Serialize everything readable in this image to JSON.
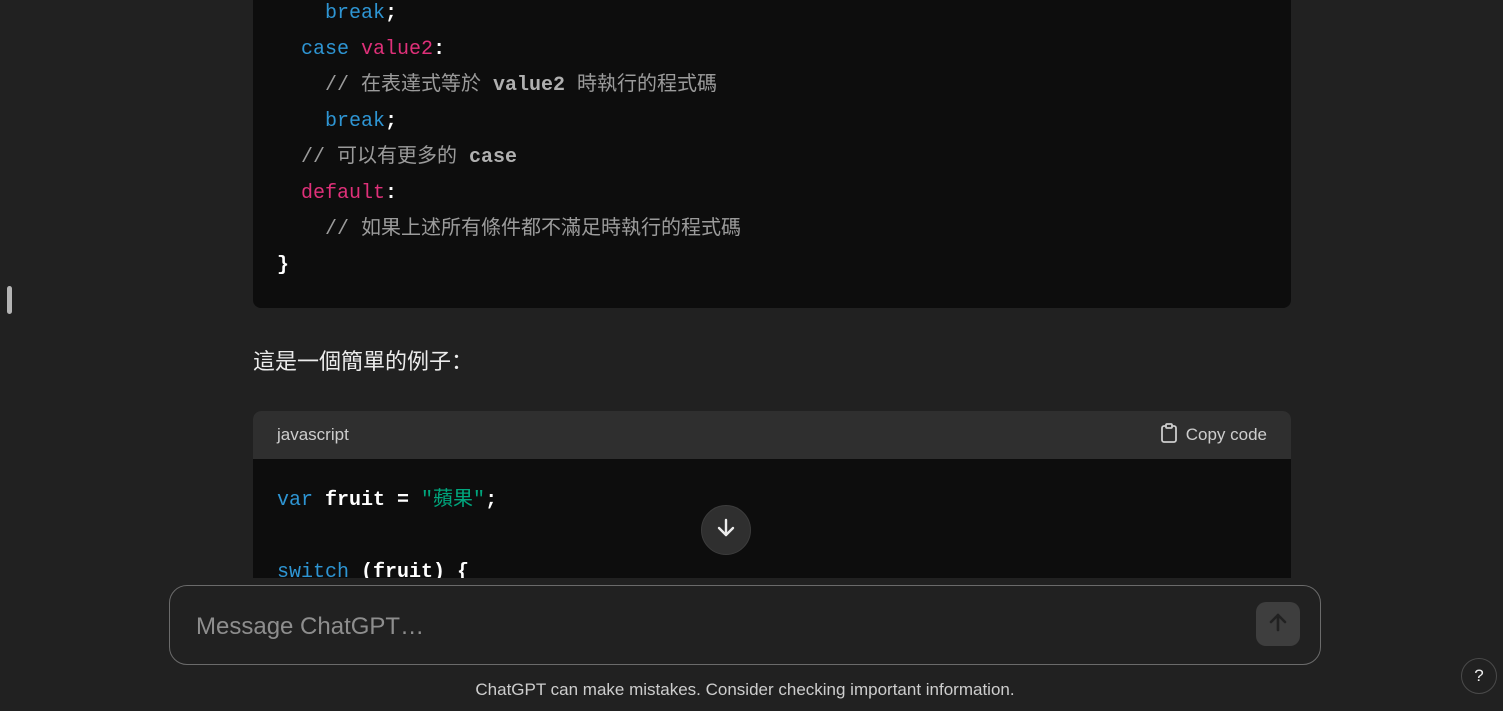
{
  "code_block_top": {
    "lines": [
      {
        "indent": "    ",
        "parts": [
          {
            "t": "break",
            "c": "kw"
          },
          {
            "t": ";",
            "c": "pl"
          }
        ]
      },
      {
        "indent": "  ",
        "parts": [
          {
            "t": "case",
            "c": "kw"
          },
          {
            "t": " ",
            "c": "pl"
          },
          {
            "t": "value2",
            "c": "str"
          },
          {
            "t": ":",
            "c": "pl"
          }
        ]
      },
      {
        "indent": "    ",
        "parts": [
          {
            "t": "// 在表達式等於 ",
            "c": "cm"
          },
          {
            "t": "value2",
            "c": "cmb"
          },
          {
            "t": " 時執行的程式碼",
            "c": "cm"
          }
        ]
      },
      {
        "indent": "    ",
        "parts": [
          {
            "t": "break",
            "c": "kw"
          },
          {
            "t": ";",
            "c": "pl"
          }
        ]
      },
      {
        "indent": "  ",
        "parts": [
          {
            "t": "// 可以有更多的 ",
            "c": "cm"
          },
          {
            "t": "case",
            "c": "cmb"
          }
        ]
      },
      {
        "indent": "  ",
        "parts": [
          {
            "t": "default",
            "c": "str"
          },
          {
            "t": ":",
            "c": "pl"
          }
        ]
      },
      {
        "indent": "    ",
        "parts": [
          {
            "t": "// 如果上述所有條件都不滿足時執行的程式碼",
            "c": "cm"
          }
        ]
      },
      {
        "indent": "",
        "parts": [
          {
            "t": "}",
            "c": "pl"
          }
        ]
      }
    ]
  },
  "paragraph": "這是一個簡單的例子：",
  "code_block_bottom": {
    "language": "javascript",
    "copy_label": "Copy code",
    "lines": [
      {
        "indent": "",
        "parts": [
          {
            "t": "var",
            "c": "kw"
          },
          {
            "t": " fruit = ",
            "c": "pl"
          },
          {
            "t": "\"蘋果\"",
            "c": "grn"
          },
          {
            "t": ";",
            "c": "pl"
          }
        ]
      },
      {
        "indent": "",
        "parts": []
      },
      {
        "indent": "",
        "parts": [
          {
            "t": "switch",
            "c": "kw"
          },
          {
            "t": " (fruit) {",
            "c": "pl"
          }
        ]
      }
    ]
  },
  "composer": {
    "placeholder": "Message ChatGPT…"
  },
  "disclaimer": "ChatGPT can make mistakes. Consider checking important information.",
  "help_label": "?",
  "icons": {
    "copy": "clipboard-icon",
    "scroll": "arrow-down-icon",
    "send": "arrow-up-icon"
  },
  "colors": {
    "background": "#212121",
    "code_bg": "#0d0d0d",
    "keyword": "#2e95d3",
    "string_pink": "#df3079",
    "string_green": "#00a67d",
    "comment": "#9b9b9b"
  }
}
